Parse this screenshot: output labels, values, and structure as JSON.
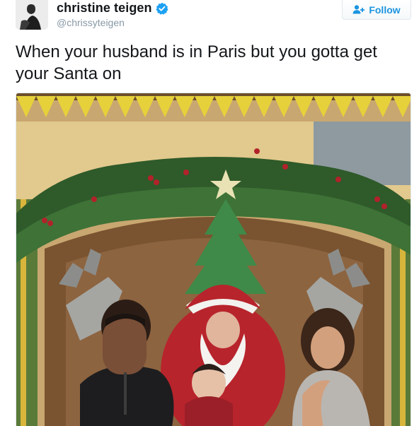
{
  "tweet": {
    "author": {
      "display_name": "christine teigen",
      "handle": "@chrissyteigen",
      "verified": true,
      "avatar_icon": "profile-photo"
    },
    "follow_button": {
      "label": "Follow",
      "icon": "add-user-icon"
    },
    "text": "When your husband is in Paris but you gotta get your Santa on",
    "media": {
      "type": "photo",
      "icon": "santa-photo"
    }
  },
  "colors": {
    "text": "#14171a",
    "secondary_text": "#8899a6",
    "accent": "#1b95e0",
    "verified": "#1da1f2",
    "border": "#e1e8ed"
  }
}
